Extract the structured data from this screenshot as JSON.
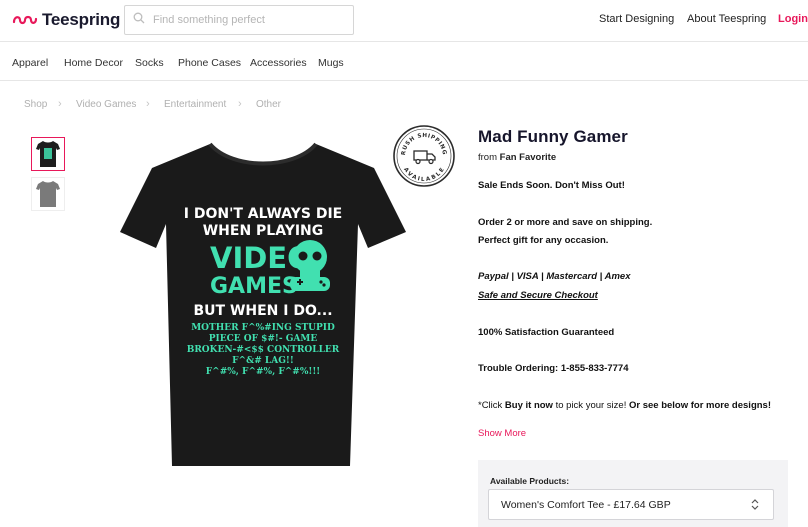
{
  "header": {
    "logo_text": "Teespring",
    "search_placeholder": "Find something perfect",
    "links": {
      "start_designing": "Start Designing",
      "about": "About Teespring",
      "login": "Login"
    },
    "brand_color": "#e8185a"
  },
  "categories": [
    "Apparel",
    "Home Decor",
    "Socks",
    "Phone Cases",
    "Accessories",
    "Mugs"
  ],
  "breadcrumb": [
    "Shop",
    "Video Games",
    "Entertainment",
    "Other"
  ],
  "badge": {
    "top_text": "RUSH SHIPPING",
    "bottom_text": "AVAILABLE"
  },
  "shirt_print": {
    "line1": "I DON'T ALWAYS DIE",
    "line2": "WHEN PLAYING",
    "line3": "VIDEO",
    "line4": "GAMES",
    "line5": "BUT WHEN I DO...",
    "line6": "MOTHER F^%#ING STUPID",
    "line7": "PIECE OF $#!- GAME",
    "line8": "BROKEN-#<$$ CONTROLLER",
    "line9": "F^&# LAG!!",
    "line10": "F^#%, F^#%, F^#%!!!"
  },
  "product": {
    "title": "Mad Funny Gamer",
    "from_prefix": "from",
    "from_store": "Fan Favorite",
    "sale": "Sale Ends Soon. Don't Miss Out!",
    "order_line1": "Order 2 or more and save on shipping.",
    "order_line2": "Perfect gift for any occasion.",
    "payment": "Paypal | VISA | Mastercard | Amex",
    "secure": "Safe and Secure Checkout",
    "guarantee": "100% Satisfaction Guaranteed",
    "trouble": "Trouble Ordering: 1-855-833-7774",
    "click_pre": "*Click ",
    "click_bold1": "Buy it now",
    "click_mid": " to pick your size! ",
    "click_bold2": "Or see below for more designs!",
    "show_more": "Show More",
    "available_label": "Available Products:",
    "selected_product": "Women's Comfort Tee - £17.64 GBP"
  }
}
